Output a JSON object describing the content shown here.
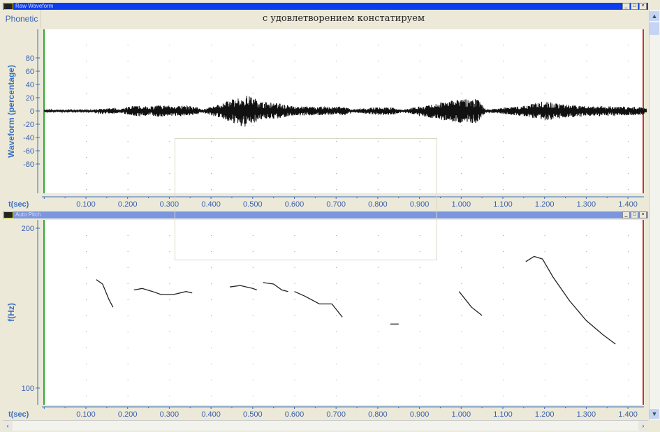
{
  "windows": {
    "waveform_title": "Raw Waveform",
    "pitch_title": "Auto Pitch"
  },
  "phonetic": {
    "label": "Phonetic",
    "text": "с удовлетворением констатируем"
  },
  "chart_data": [
    {
      "type": "line",
      "title": "Raw Waveform",
      "xlabel": "t(sec)",
      "ylabel": "Waveform (percentage)",
      "xlim": [
        0,
        1.445
      ],
      "ylim": [
        -100,
        100
      ],
      "xticks": [
        "0.100",
        "0.200",
        "0.300",
        "0.400",
        "0.500",
        "0.600",
        "0.700",
        "0.800",
        "0.900",
        "1.000",
        "1.100",
        "1.200",
        "1.300",
        "1.400"
      ],
      "yticks": [
        "80",
        "60",
        "40",
        "20",
        "0",
        "-20",
        "-40",
        "-60",
        "-80"
      ],
      "envelope": [
        [
          0,
          2
        ],
        [
          0.12,
          2
        ],
        [
          0.13,
          4
        ],
        [
          0.17,
          4
        ],
        [
          0.18,
          2
        ],
        [
          0.21,
          8
        ],
        [
          0.26,
          7
        ],
        [
          0.27,
          9
        ],
        [
          0.36,
          7
        ],
        [
          0.38,
          2
        ],
        [
          0.44,
          15
        ],
        [
          0.48,
          25
        ],
        [
          0.51,
          18
        ],
        [
          0.52,
          14
        ],
        [
          0.56,
          12
        ],
        [
          0.59,
          8
        ],
        [
          0.6,
          7
        ],
        [
          0.72,
          6
        ],
        [
          0.74,
          2
        ],
        [
          0.8,
          6
        ],
        [
          0.84,
          5
        ],
        [
          0.86,
          2
        ],
        [
          0.99,
          18
        ],
        [
          1.04,
          18
        ],
        [
          1.06,
          2
        ],
        [
          1.15,
          8
        ],
        [
          1.2,
          15
        ],
        [
          1.25,
          10
        ],
        [
          1.3,
          8
        ],
        [
          1.43,
          6
        ],
        [
          1.445,
          3
        ]
      ]
    },
    {
      "type": "line",
      "title": "Auto Pitch",
      "xlabel": "t(sec)",
      "ylabel": "f(Hz)",
      "xlim": [
        0,
        1.445
      ],
      "ylim": [
        100,
        200
      ],
      "yscale": "log",
      "xticks": [
        "0.100",
        "0.200",
        "0.300",
        "0.400",
        "0.500",
        "0.600",
        "0.700",
        "0.800",
        "0.900",
        "1.000",
        "1.100",
        "1.200",
        "1.300",
        "1.400"
      ],
      "yticks": [
        "200",
        "100"
      ],
      "series": [
        [
          [
            0.125,
            160
          ],
          [
            0.14,
            157
          ],
          [
            0.155,
            147
          ],
          [
            0.165,
            142
          ]
        ],
        [
          [
            0.215,
            153
          ],
          [
            0.235,
            154
          ],
          [
            0.26,
            152
          ],
          [
            0.28,
            150
          ],
          [
            0.31,
            150
          ],
          [
            0.34,
            152
          ],
          [
            0.355,
            151
          ]
        ],
        [
          [
            0.445,
            155
          ],
          [
            0.47,
            156
          ],
          [
            0.5,
            154
          ],
          [
            0.51,
            153
          ]
        ],
        [
          [
            0.525,
            158
          ],
          [
            0.55,
            157
          ],
          [
            0.57,
            153
          ],
          [
            0.585,
            152
          ]
        ],
        [
          [
            0.6,
            152
          ],
          [
            0.625,
            149
          ],
          [
            0.66,
            144
          ],
          [
            0.69,
            144
          ],
          [
            0.715,
            136
          ]
        ],
        [
          [
            0.83,
            132
          ],
          [
            0.85,
            132
          ]
        ],
        [
          [
            0.995,
            152
          ],
          [
            1.025,
            142
          ],
          [
            1.05,
            137
          ]
        ],
        [
          [
            1.155,
            173
          ],
          [
            1.175,
            177
          ],
          [
            1.195,
            175
          ],
          [
            1.22,
            162
          ],
          [
            1.26,
            146
          ],
          [
            1.3,
            134
          ],
          [
            1.34,
            126
          ],
          [
            1.37,
            121
          ]
        ]
      ]
    }
  ]
}
